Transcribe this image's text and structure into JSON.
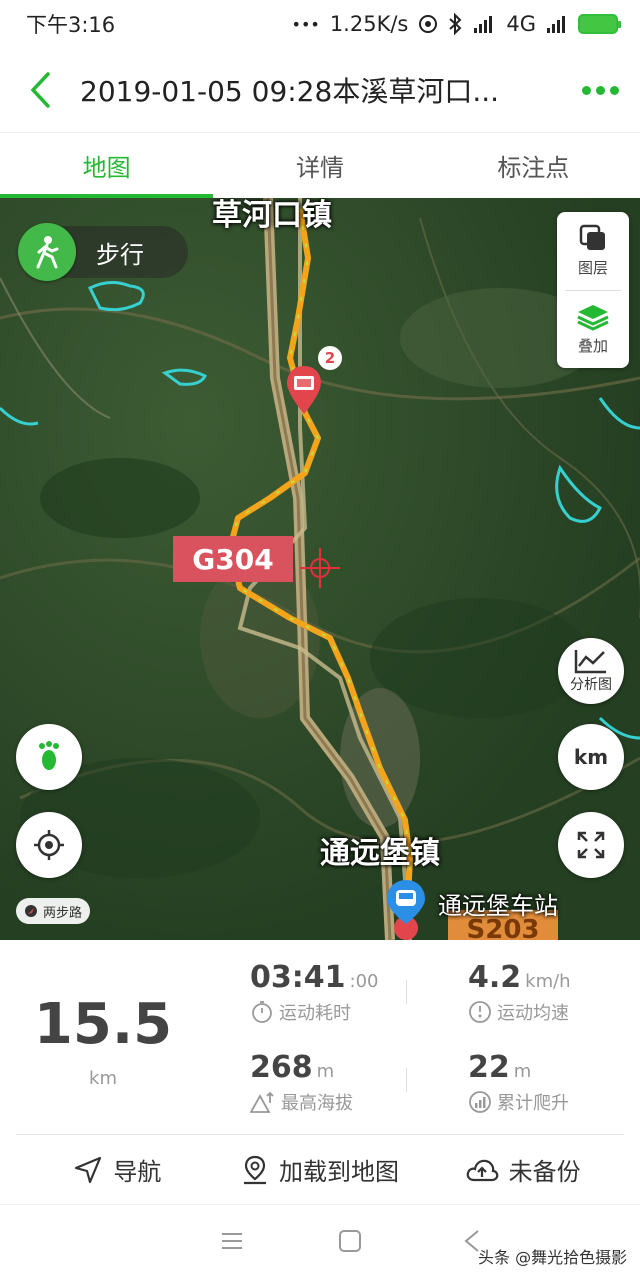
{
  "status_bar": {
    "time": "下午3:16",
    "dots": "•••",
    "speed": "1.25K/s",
    "network": "4G"
  },
  "header": {
    "title": "2019-01-05 09:28本溪草河口..."
  },
  "tabs": [
    {
      "label": "地图",
      "active": true
    },
    {
      "label": "详情",
      "active": false
    },
    {
      "label": "标注点",
      "active": false
    }
  ],
  "map": {
    "mode_label": "步行",
    "layers_label": "图层",
    "overlay_label": "叠加",
    "analysis_label": "分析图",
    "km_label": "km",
    "photo_badge": "2",
    "place_top": "草河口镇",
    "place_bottom": "通远堡镇",
    "road_label": "G304",
    "station_label": "通远堡车站",
    "road_bottom": "S203",
    "scale_label": "两步路",
    "accent_color": "#25b833"
  },
  "stats": {
    "distance": {
      "value": "15.5",
      "unit": "km"
    },
    "duration": {
      "value": "03:41",
      "suffix": ":00",
      "label": "运动耗时"
    },
    "avg_speed": {
      "value": "4.2",
      "unit": "km/h",
      "label": "运动均速"
    },
    "max_altitude": {
      "value": "268",
      "unit": "m",
      "label": "最高海拔"
    },
    "climb": {
      "value": "22",
      "unit": "m",
      "label": "累计爬升"
    }
  },
  "actions": {
    "navigate": "导航",
    "load_map": "加载到地图",
    "backup": "未备份"
  },
  "watermark": "头条 @舞光拾色摄影"
}
